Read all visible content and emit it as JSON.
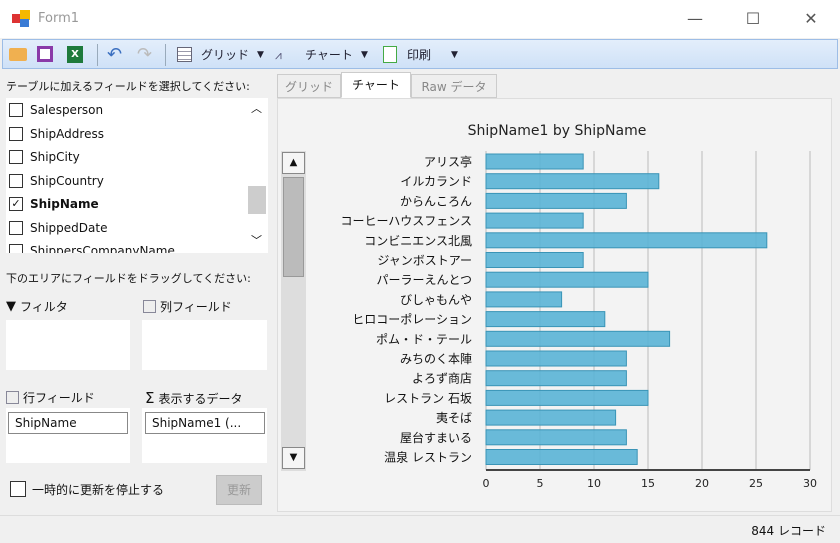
{
  "window": {
    "title": "Form1",
    "controls": {
      "minimize": "—",
      "maximize": "☐",
      "close": "✕"
    }
  },
  "toolbar": {
    "grid_label": "グリッド",
    "chart_label": "チャート",
    "print_label": "印刷",
    "dropdown": "▼"
  },
  "left": {
    "select_label": "テーブルに加えるフィールドを選択してください:",
    "fields": [
      {
        "name": "Salesperson",
        "checked": false
      },
      {
        "name": "ShipAddress",
        "checked": false
      },
      {
        "name": "ShipCity",
        "checked": false
      },
      {
        "name": "ShipCountry",
        "checked": false
      },
      {
        "name": "ShipName",
        "checked": true
      },
      {
        "name": "ShippedDate",
        "checked": false
      },
      {
        "name": "ShippersCompanyName",
        "checked": false
      }
    ],
    "drag_label": "下のエリアにフィールドをドラッグしてください:",
    "filter_label": "フィルタ",
    "column_label": "列フィールド",
    "row_label": "行フィールド",
    "data_label": "表示するデータ",
    "row_value": "ShipName",
    "data_value": "ShipName1 (...",
    "defer_label": "一時的に更新を停止する",
    "update_label": "更新"
  },
  "tabs": [
    {
      "label": "グリッド"
    },
    {
      "label": "チャート"
    },
    {
      "label": "Raw データ"
    }
  ],
  "status": {
    "records": "844 レコード"
  },
  "colors": {
    "bar": "#5ab4d6",
    "bar_border": "#3a94b6"
  },
  "chart_data": {
    "type": "bar",
    "orientation": "horizontal",
    "title": "ShipName1 by ShipName",
    "categories": [
      "アリス亭",
      "イルカランド",
      "からんころん",
      "コーヒーハウスフェンス",
      "コンビニエンス北風",
      "ジャンボストアー",
      "パーラーえんとつ",
      "びしゃもんや",
      "ヒロコーポレーション",
      "ポム・ド・テール",
      "みちのく本陣",
      "よろず商店",
      "レストラン 石坂",
      "夷そば",
      "屋台すまいる",
      "温泉 レストラン"
    ],
    "values": [
      9,
      16,
      13,
      9,
      26,
      9,
      15,
      7,
      11,
      17,
      13,
      13,
      15,
      12,
      13,
      14
    ],
    "xlim": [
      0,
      30
    ],
    "xticks": [
      0,
      5,
      10,
      15,
      20,
      25,
      30
    ],
    "grid": true
  }
}
